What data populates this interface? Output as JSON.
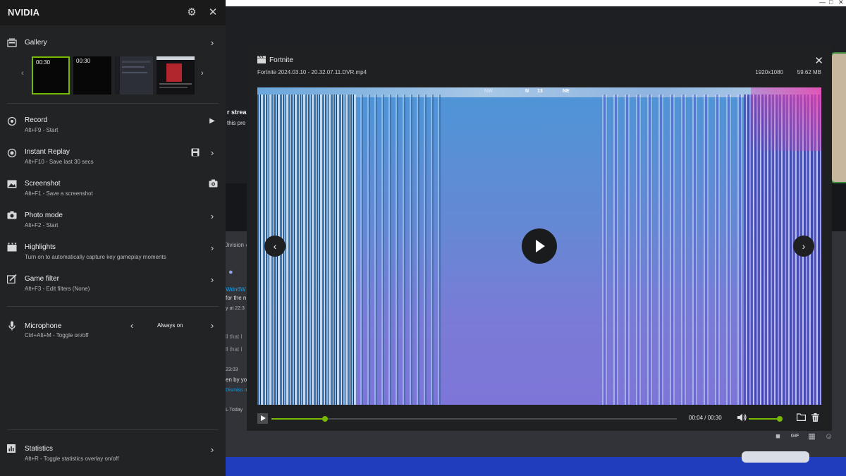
{
  "background_app": {
    "window_controls": [
      "—",
      "□",
      "✕"
    ],
    "snippets": {
      "stream_heading": "r strea",
      "stream_sub": "this pre",
      "division": "Division ‹",
      "link_name": "Wdn6W",
      "for_the": "for the n",
      "yesterday": "y at 22:3",
      "all_that_1": "ll that I",
      "all_that_2": "ll that I",
      "time_2303": "23:03",
      "seen_by": "en by yo",
      "dismiss": "Dismiss m",
      "today": "L Today"
    },
    "input_icons": [
      "gift-icon",
      "gif-icon",
      "sticker-icon",
      "emoji-icon"
    ]
  },
  "panel": {
    "title": "NVIDIA",
    "gallery": {
      "label": "Gallery",
      "thumbnails": [
        {
          "time": "00:30",
          "selected": true
        },
        {
          "time": "00:30",
          "selected": false
        },
        {
          "time": "",
          "selected": false
        },
        {
          "time": "",
          "selected": false
        }
      ]
    },
    "record": {
      "label": "Record",
      "shortcut": "Alt+F9 - Start"
    },
    "instant_replay": {
      "label": "Instant Replay",
      "shortcut": "Alt+F10 - Save last 30 secs"
    },
    "screenshot": {
      "label": "Screenshot",
      "shortcut": "Alt+F1 - Save a screenshot"
    },
    "photo_mode": {
      "label": "Photo mode",
      "shortcut": "Alt+F2 - Start"
    },
    "highlights": {
      "label": "Highlights",
      "shortcut": "Turn on to automatically capture key gameplay moments"
    },
    "game_filter": {
      "label": "Game filter",
      "shortcut": "Alt+F3 - Edit filters (None)"
    },
    "microphone": {
      "label": "Microphone",
      "shortcut": "Ctrl+Alt+M - Toggle on/off",
      "value": "Always on"
    },
    "statistics": {
      "label": "Statistics",
      "shortcut": "Alt+R - Toggle statistics overlay on/off"
    }
  },
  "viewer": {
    "title": "Fortnite",
    "filename": "Fortnite 2024.03.10 - 20.32.07.11.DVR.mp4",
    "resolution": "1920x1080",
    "filesize": "59.62 MB",
    "hud": {
      "nw": "NW",
      "n": "N",
      "num": "13",
      "ne": "NE"
    },
    "playback": {
      "time": "00:04 / 00:30",
      "progress": 0.133,
      "volume": 1.0
    }
  },
  "colors": {
    "accent": "#76b900",
    "panel_bg": "#222325",
    "viewer_bg": "#1f2022"
  }
}
